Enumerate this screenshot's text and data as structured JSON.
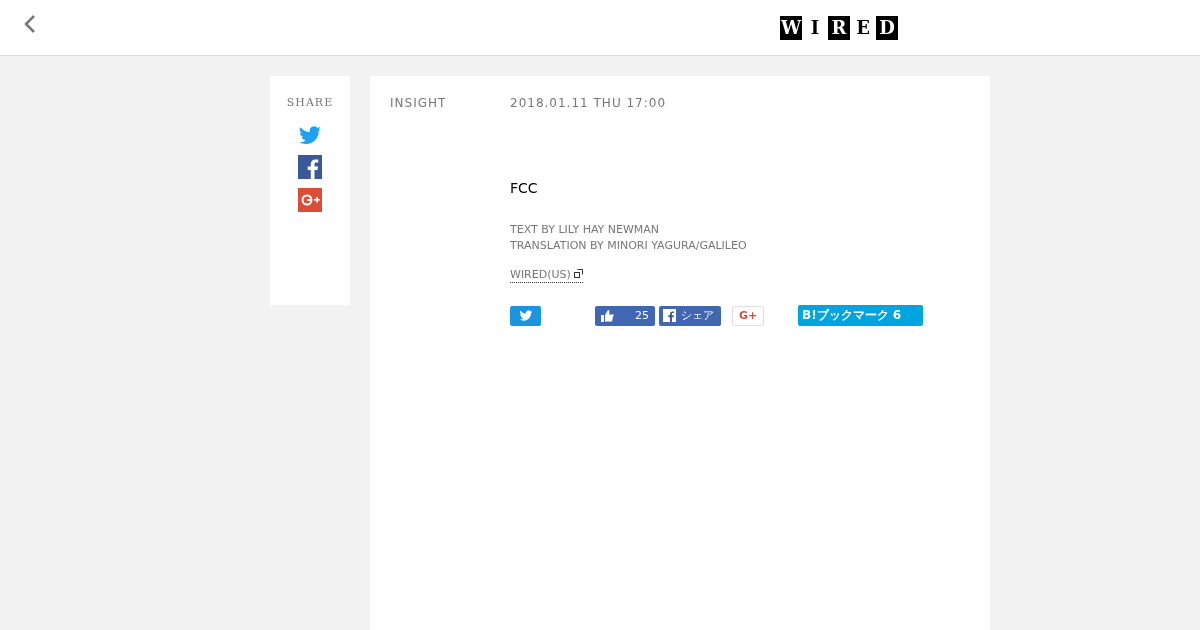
{
  "logo": [
    {
      "letter": "W",
      "inverted": true
    },
    {
      "letter": "I",
      "inverted": false
    },
    {
      "letter": "R",
      "inverted": true
    },
    {
      "letter": "E",
      "inverted": false
    },
    {
      "letter": "D",
      "inverted": true
    }
  ],
  "share": {
    "title": "SHARE"
  },
  "article": {
    "category": "INSIGHT",
    "date": "2018.01.11 THU 17:00",
    "title": "FCC",
    "credits": [
      "TEXT BY LILY HAY NEWMAN",
      "TRANSLATION BY MINORI YAGURA/GALILEO"
    ],
    "source": "WIRED(US)"
  },
  "social_buttons": [
    {
      "kind": "tweet"
    },
    {
      "kind": "like",
      "count": "25"
    },
    {
      "kind": "fbshare",
      "label": "シェア"
    },
    {
      "kind": "gplus",
      "label": "G+"
    },
    {
      "kind": "hatena",
      "label": "B!ブックマーク 6"
    }
  ]
}
